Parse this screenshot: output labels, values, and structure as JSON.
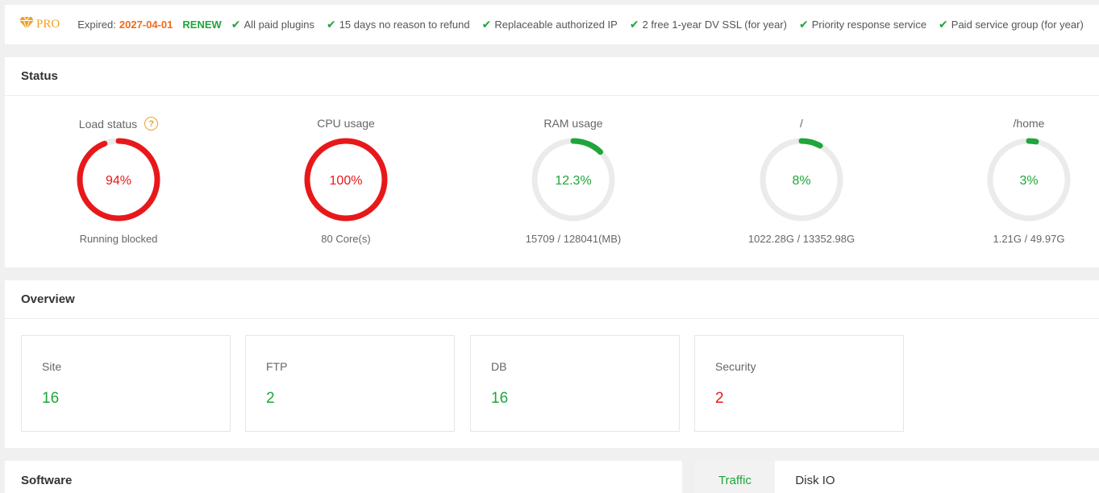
{
  "pro_bar": {
    "logo_text": "PRO",
    "expired_label": "Expired:",
    "expired_date": "2027-04-01",
    "renew_label": "RENEW",
    "perks": [
      "All paid plugins",
      "15 days no reason to refund",
      "Replaceable authorized IP",
      "2 free 1-year DV SSL (for year)",
      "Priority response service",
      "Paid service group (for year)"
    ]
  },
  "status": {
    "title": "Status",
    "gauges": [
      {
        "label": "Load status",
        "value_text": "94%",
        "percent": 94,
        "sub": "Running blocked",
        "color": "#e8181a"
      },
      {
        "label": "CPU usage",
        "value_text": "100%",
        "percent": 100,
        "sub": "80 Core(s)",
        "color": "#e8181a"
      },
      {
        "label": "RAM usage",
        "value_text": "12.3%",
        "percent": 12.3,
        "sub": "15709 / 128041(MB)",
        "color": "#20a53a"
      },
      {
        "label": "/",
        "value_text": "8%",
        "percent": 8,
        "sub": "1022.28G / 13352.98G",
        "color": "#20a53a"
      },
      {
        "label": "/home",
        "value_text": "3%",
        "percent": 3,
        "sub": "1.21G / 49.97G",
        "color": "#20a53a"
      }
    ]
  },
  "overview": {
    "title": "Overview",
    "cards": [
      {
        "label": "Site",
        "value": "16",
        "color": "#20a53a"
      },
      {
        "label": "FTP",
        "value": "2",
        "color": "#20a53a"
      },
      {
        "label": "DB",
        "value": "16",
        "color": "#20a53a"
      },
      {
        "label": "Security",
        "value": "2",
        "color": "#e8181a"
      }
    ]
  },
  "software": {
    "title": "Software"
  },
  "traffic": {
    "tabs": [
      "Traffic",
      "Disk IO"
    ]
  },
  "colors": {
    "accent": "#20a53a",
    "danger": "#e8181a",
    "warning": "#f06a1c",
    "gold": "#f0a020",
    "track": "#ebebeb"
  }
}
